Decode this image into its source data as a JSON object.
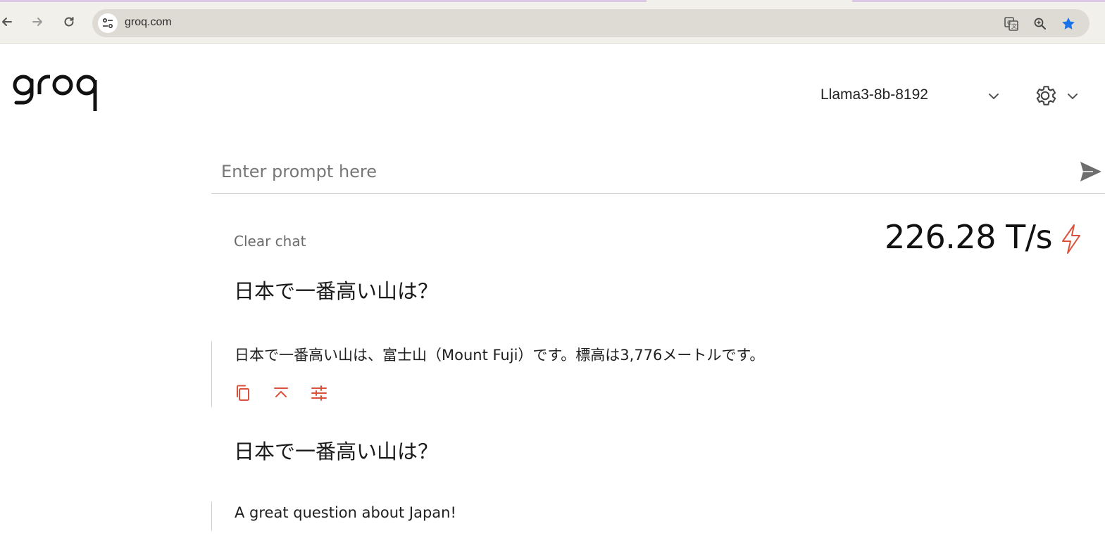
{
  "browser": {
    "url": "groq.com",
    "icons": [
      "back-icon",
      "forward-icon",
      "reload-icon",
      "site-settings-icon",
      "translate-icon",
      "zoom-icon",
      "bookmark-star-icon"
    ],
    "star_color": "#1a73e8"
  },
  "header": {
    "logo_text": "groq",
    "model_select": "Llama3-8b-8192"
  },
  "prompt": {
    "placeholder": "Enter prompt here"
  },
  "chat": {
    "clear_label": "Clear chat",
    "speed": "226.28 T/s",
    "accent_color": "#d9533c",
    "messages": [
      {
        "question": "日本で一番高い山は？",
        "answer": "日本で一番高い山は、富士山（Mount Fuji）です。標高は3,776メートルです。"
      },
      {
        "question": "日本で一番高い山は？",
        "answer": "A great question about Japan!"
      }
    ]
  }
}
